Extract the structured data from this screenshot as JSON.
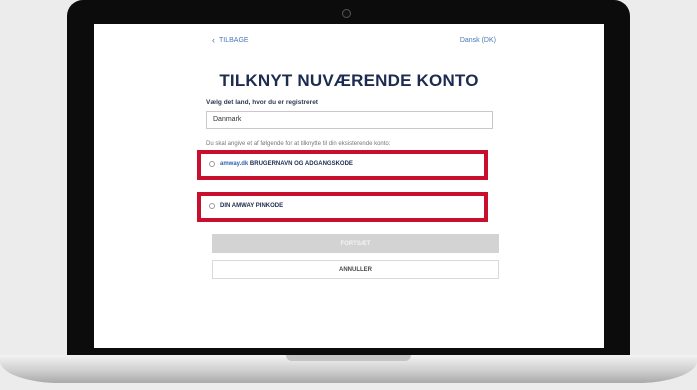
{
  "nav": {
    "back_label": "TILBAGE",
    "language": "Dansk (DK)"
  },
  "page": {
    "title": "TILKNYT NUVÆRENDE KONTO"
  },
  "country": {
    "label": "Vælg det land, hvor du er registreret",
    "selected": "Danmark"
  },
  "instruction": "Du skal angive et af følgende for at tilknytte til din eksisterende konto:",
  "options": [
    {
      "brand": "amway.dk",
      "label": " BRUGERNAVN OG ADGANGSKODE"
    },
    {
      "brand": "",
      "label": "DIN AMWAY PINKODE"
    }
  ],
  "buttons": {
    "continue": "FORTSÆT",
    "cancel": "ANNULLER"
  },
  "colors": {
    "highlight": "#c8102e",
    "title": "#1d2b50",
    "link": "#4a78b6"
  }
}
